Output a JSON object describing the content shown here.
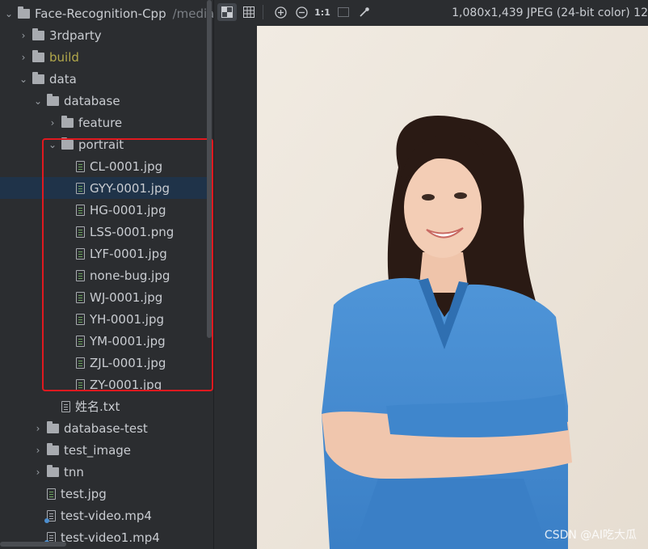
{
  "project": {
    "name": "Face-Recognition-Cpp",
    "path_hint": "/media/"
  },
  "tree": [
    {
      "label": "3rdparty",
      "type": "folder",
      "expand": "collapsed"
    },
    {
      "label": "build",
      "type": "folder",
      "expand": "collapsed",
      "style": "build"
    },
    {
      "label": "data",
      "type": "folder",
      "expand": "expanded"
    },
    {
      "label": "database",
      "type": "folder",
      "expand": "expanded"
    },
    {
      "label": "feature",
      "type": "folder",
      "expand": "collapsed"
    },
    {
      "label": "portrait",
      "type": "folder",
      "expand": "expanded"
    },
    {
      "label": "CL-0001.jpg",
      "type": "image"
    },
    {
      "label": "GYY-0001.jpg",
      "type": "image",
      "selected": true
    },
    {
      "label": "HG-0001.jpg",
      "type": "image"
    },
    {
      "label": "LSS-0001.png",
      "type": "image"
    },
    {
      "label": "LYF-0001.jpg",
      "type": "image"
    },
    {
      "label": "none-bug.jpg",
      "type": "image"
    },
    {
      "label": "WJ-0001.jpg",
      "type": "image"
    },
    {
      "label": "YH-0001.jpg",
      "type": "image"
    },
    {
      "label": "YM-0001.jpg",
      "type": "image"
    },
    {
      "label": "ZJL-0001.jpg",
      "type": "image"
    },
    {
      "label": "ZY-0001.jpg",
      "type": "image"
    },
    {
      "label": "姓名.txt",
      "type": "text"
    },
    {
      "label": "database-test",
      "type": "folder",
      "expand": "collapsed"
    },
    {
      "label": "test_image",
      "type": "folder",
      "expand": "collapsed"
    },
    {
      "label": "tnn",
      "type": "folder",
      "expand": "collapsed"
    },
    {
      "label": "test.jpg",
      "type": "image"
    },
    {
      "label": "test-video.mp4",
      "type": "video"
    },
    {
      "label": "test-video1.mp4",
      "type": "video"
    }
  ],
  "viewer": {
    "toolbar": {
      "transparency_icon": "checkerboard-icon",
      "grid_icon": "grid-icon",
      "zoom_in_icon": "zoom-in-icon",
      "zoom_out_icon": "zoom-out-icon",
      "actual_size_label": "1:1",
      "fit_icon": "fit-window-icon",
      "color_picker_icon": "eyedropper-icon"
    },
    "image_info": "1,080x1,439 JPEG (24-bit color) 12",
    "watermark": "CSDN @AI吃大瓜"
  },
  "colors": {
    "selection": "#1f3349",
    "highlight_box": "#e0191f",
    "build_folder": "#b2a84b",
    "panel_bg": "#2b2d30"
  }
}
